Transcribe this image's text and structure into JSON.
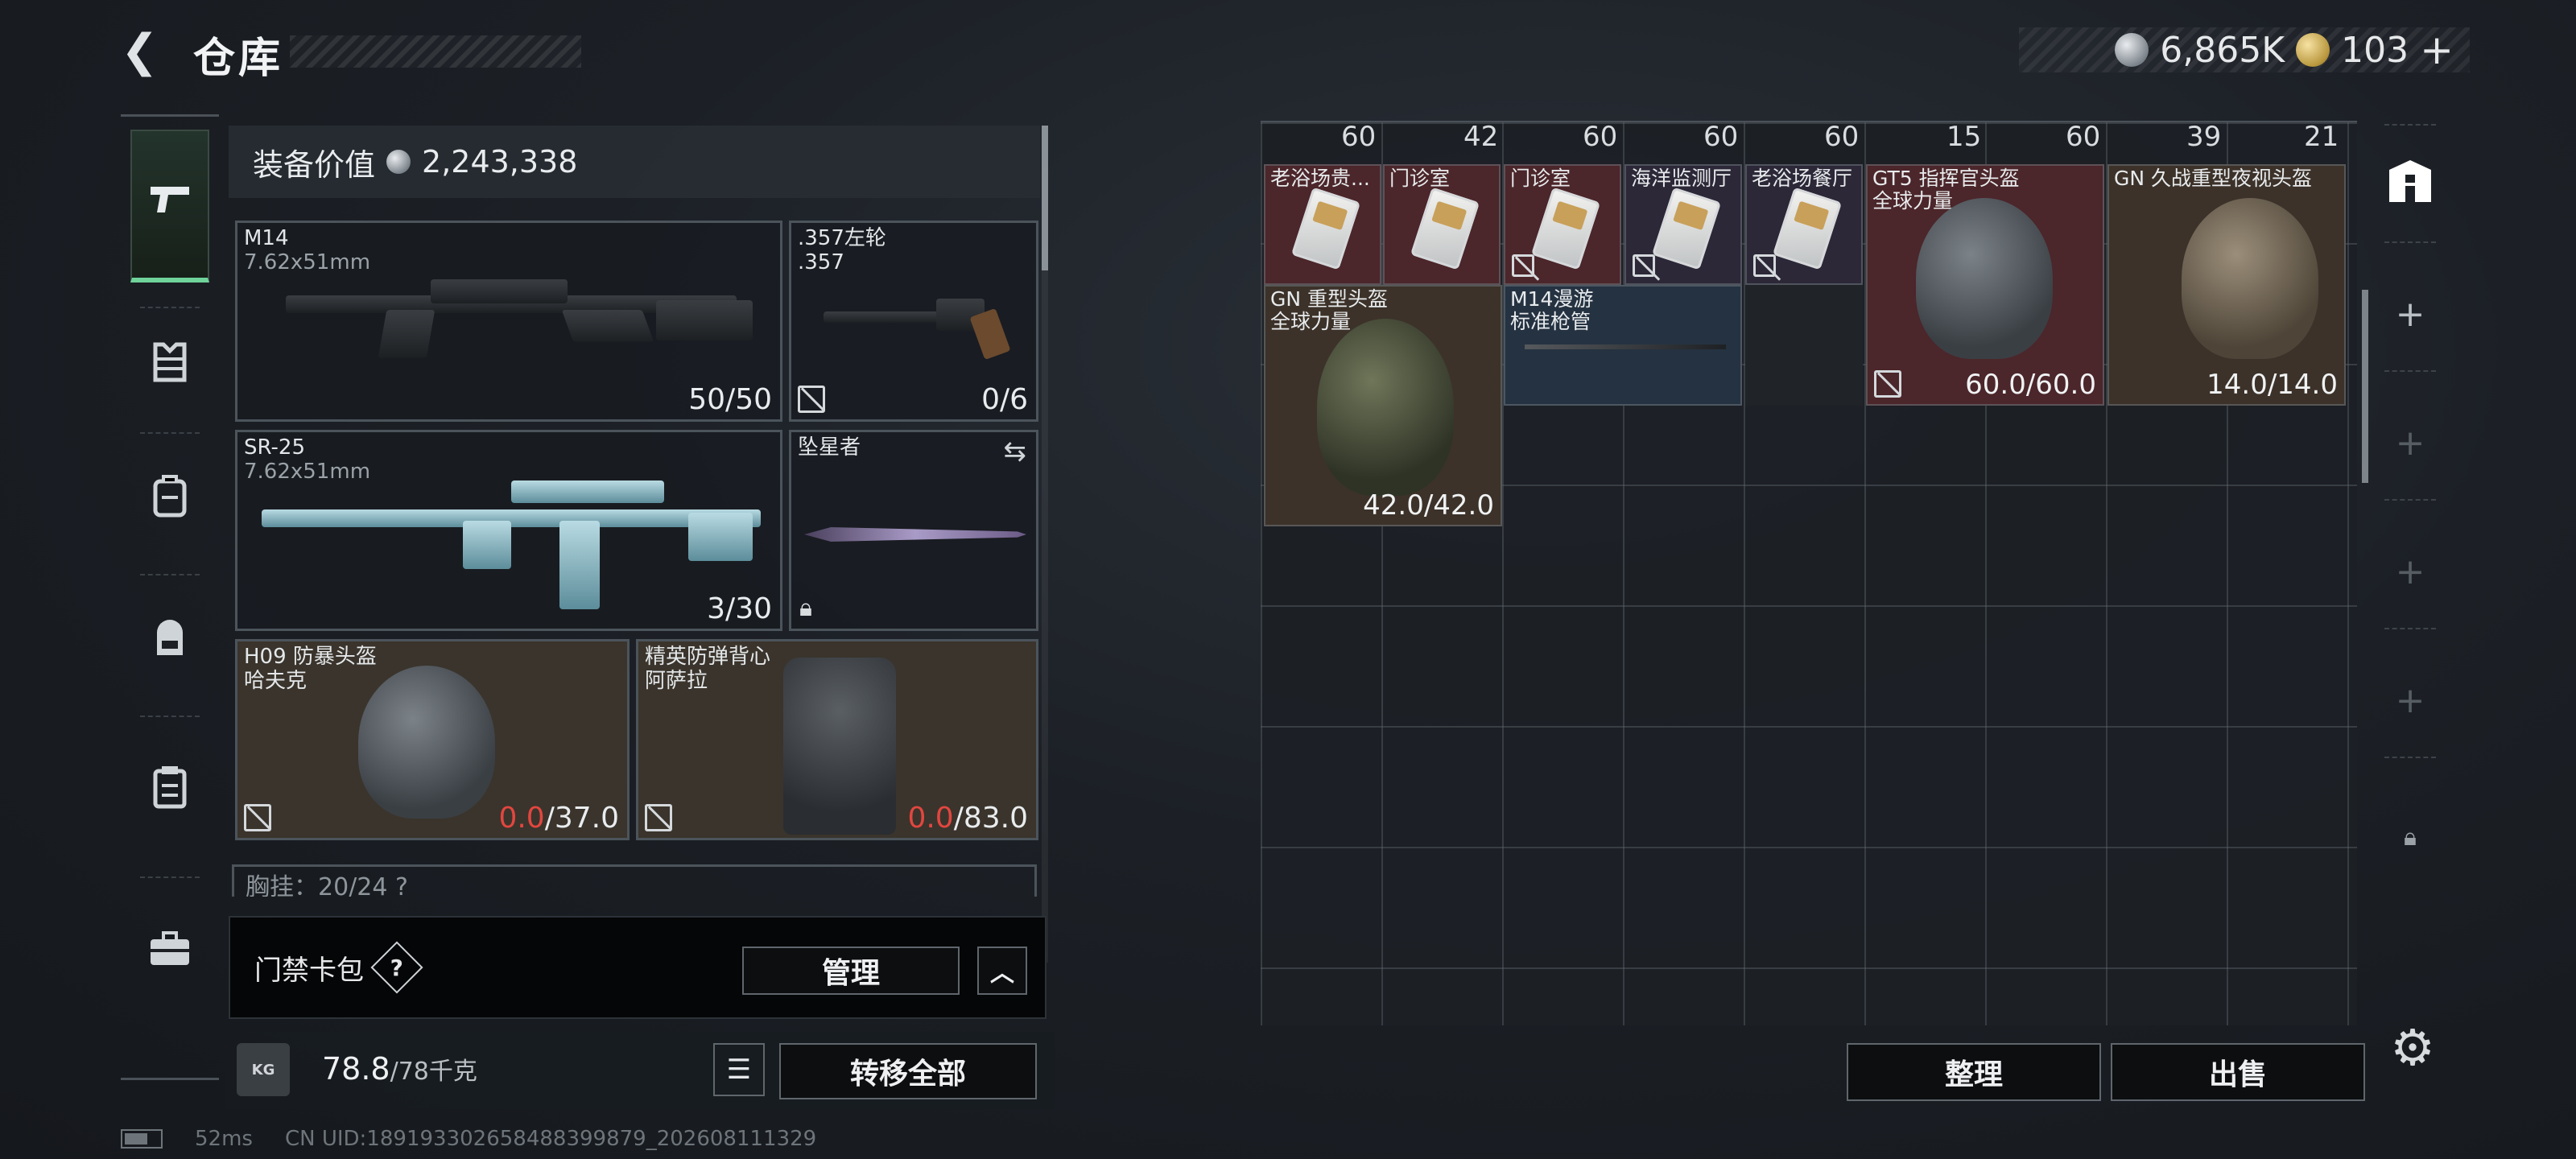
{
  "header": {
    "title": "仓库",
    "currency": [
      {
        "icon": "silver-coin-icon",
        "amount": "6,865K"
      },
      {
        "icon": "gold-coin-icon",
        "amount": "103"
      }
    ],
    "add_currency": "+"
  },
  "nav": {
    "items": [
      {
        "icon": "pistol-icon",
        "active": true
      },
      {
        "icon": "armor-vest-icon",
        "active": false
      },
      {
        "icon": "backpack-alt-icon",
        "active": false
      },
      {
        "icon": "backpack-icon",
        "active": false
      },
      {
        "icon": "clipboard-icon",
        "active": false
      },
      {
        "icon": "briefcase-icon",
        "active": false
      }
    ]
  },
  "loadout": {
    "value_label": "装备价值",
    "value_amount": "2,243,338",
    "slots": {
      "primary": {
        "name": "M14",
        "caliber": "7.62x51mm",
        "ammo": "50/50"
      },
      "sidearm": {
        "name": ".357左轮\n.357",
        "ammo": "0/6"
      },
      "secondary": {
        "name": "SR-25",
        "caliber": "7.62x51mm",
        "ammo": "3/30"
      },
      "melee": {
        "name": "坠星者"
      },
      "helmet": {
        "name": "H09 防暴头盔\n哈夫克",
        "durability_current": "0.0",
        "durability_max": "/37.0"
      },
      "armor": {
        "name": "精英防弹背心\n阿萨拉",
        "durability_current": "0.0",
        "durability_max": "/83.0"
      }
    },
    "chest_peek": "胸挂：20/24  ?"
  },
  "keycard_pouch": {
    "label": "门禁卡包",
    "help": "?",
    "manage_label": "管理",
    "caret": "^"
  },
  "weight": {
    "kg_icon": "KG",
    "current": "78.8",
    "max": "/78千克",
    "transfer_all_label": "转移全部"
  },
  "status_bar": {
    "ping": "52ms",
    "uid": "CN UID:18919330265848839987​9_202608111329"
  },
  "stash": {
    "top_counts": [
      "60",
      "42",
      "60",
      "60",
      "60",
      "15",
      "60",
      "39",
      "21"
    ],
    "items": [
      {
        "name": "老浴场贵...",
        "tint": "red"
      },
      {
        "name": "门诊室",
        "tint": "red"
      },
      {
        "name": "门诊室",
        "tint": "red"
      },
      {
        "name": "海洋监测厅",
        "tint": "purple"
      },
      {
        "name": "老浴场餐厅",
        "tint": "purple"
      },
      {
        "name": "GT5 指挥官头盔\n全球力量",
        "durability": "60.0/60.0",
        "tint": "red"
      },
      {
        "name": "GN 久战重型夜视头盔",
        "durability": "14.0/14.0",
        "tint": "brown"
      },
      {
        "name": "GN 重型头盔\n全球力量",
        "durability": "42.0/42.0",
        "tint": "brown"
      },
      {
        "name": "M14漫游\n标准枪管",
        "tint": "blue"
      }
    ],
    "sort_label": "整理",
    "sell_label": "出售"
  },
  "right_rail": {
    "items": [
      "container-icon",
      "+",
      "+",
      "+",
      "+",
      "lock-icon"
    ]
  }
}
